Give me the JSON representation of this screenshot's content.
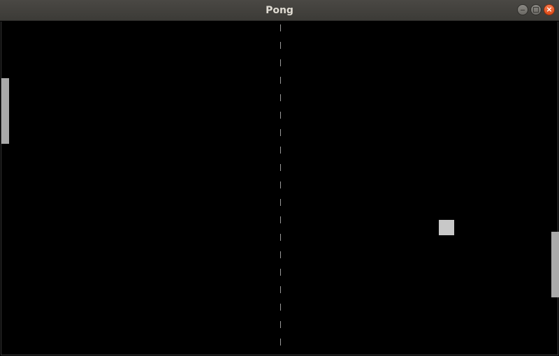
{
  "window": {
    "title": "Pong",
    "controls": {
      "minimize_icon": "minimize-icon",
      "maximize_icon": "maximize-icon",
      "close_icon": "close-icon",
      "close_glyph": "×"
    }
  },
  "game": {
    "background_color": "#000000",
    "paddle_color": "#aaaaaa",
    "ball_color": "#c8c8c8",
    "net_color": "#9a9a9a"
  }
}
